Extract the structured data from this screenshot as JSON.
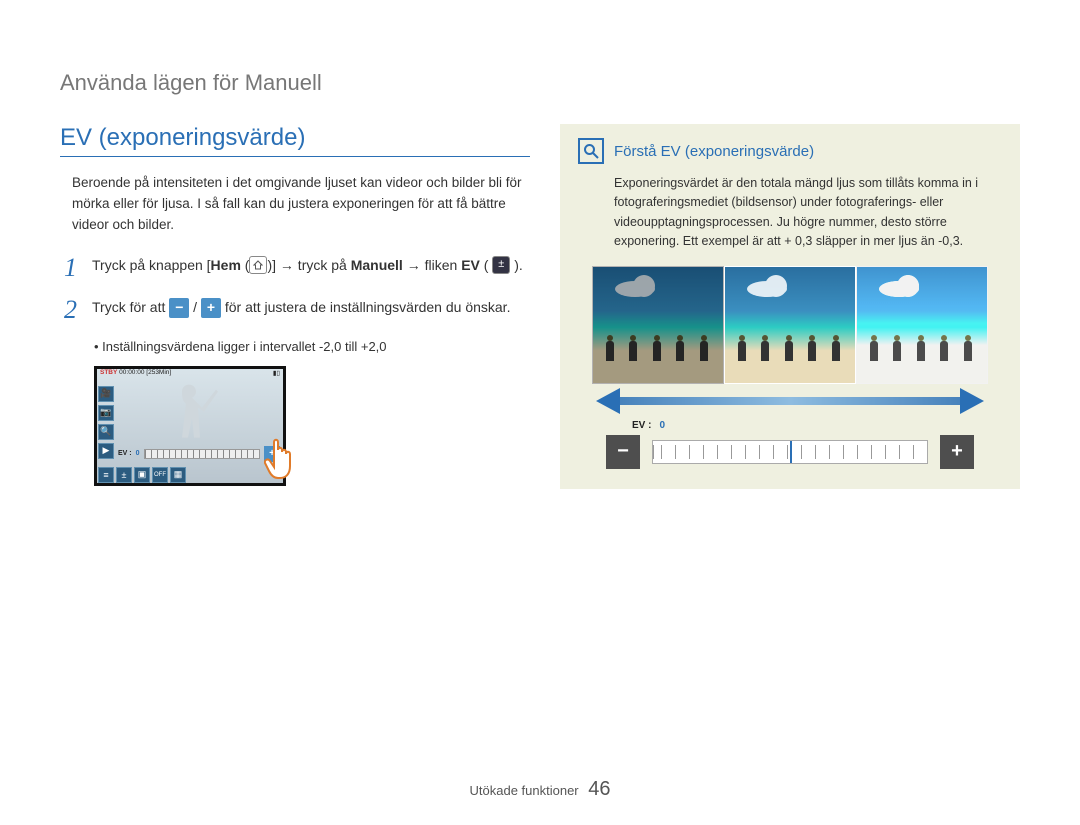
{
  "breadcrumb": "Använda lägen för Manuell",
  "left": {
    "title": "EV (exponeringsvärde)",
    "intro": "Beroende på intensiteten i det omgivande ljuset kan videor och bilder bli för mörka eller för ljusa. I så fall kan du justera exponeringen för att få bättre videor och bilder.",
    "step1_pre": "Tryck på knappen [",
    "step1_hem": "Hem",
    "step1_mid": " (",
    "step1_mid2": ")] → tryck på ",
    "step1_man": "Manuell",
    "step1_after": " → fliken ",
    "step1_ev": "EV",
    "step1_end": " ( ",
    "step1_close": " ).",
    "step2_pre": "Tryck för att ",
    "step2_mid": " / ",
    "step2_after": " för att justera de inställningsvärden du önskar.",
    "bullet": "Inställningsvärdena ligger i intervallet -2,0 till +2,0",
    "cam": {
      "stby": "STBY",
      "time": "00:00:00",
      "remain": "[253Min]",
      "ev_label": "EV :",
      "ev_value": "0"
    }
  },
  "right": {
    "title": "Förstå EV (exponeringsvärde)",
    "body": "Exponeringsvärdet är den totala mängd ljus som tillåts komma in i fotograferingsmediet (bildsensor) under fotograferings- eller videoupptagningsprocessen. Ju högre nummer, desto större exponering. Ett exempel är att + 0,3 släpper in mer ljus än -0,3.",
    "slider_label": "EV :",
    "slider_value": "0"
  },
  "footer": {
    "section": "Utökade funktioner",
    "page": "46"
  }
}
